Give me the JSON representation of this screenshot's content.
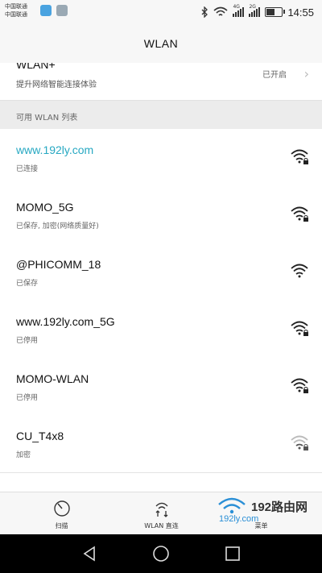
{
  "status_bar": {
    "carrier_1": "中国联通",
    "carrier_2": "中国联通",
    "net_1": "4G",
    "net_2": "2G",
    "time": "14:55"
  },
  "header": {
    "title": "WLAN"
  },
  "wlan_plus": {
    "name": "WLAN+",
    "subtitle": "提升网络智能连接体验",
    "value": "已开启"
  },
  "section": {
    "label": "可用 WLAN 列表"
  },
  "networks": [
    {
      "ssid": "www.192ly.com",
      "status": "已连接",
      "connected": true,
      "locked": true,
      "signal": 4
    },
    {
      "ssid": "MOMO_5G",
      "status": "已保存, 加密(网络质量好)",
      "connected": false,
      "locked": true,
      "signal": 4
    },
    {
      "ssid": "@PHICOMM_18",
      "status": "已保存",
      "connected": false,
      "locked": false,
      "signal": 4
    },
    {
      "ssid": "www.192ly.com_5G",
      "status": "已停用",
      "connected": false,
      "locked": true,
      "signal": 4
    },
    {
      "ssid": "MOMO-WLAN",
      "status": "已停用",
      "connected": false,
      "locked": true,
      "signal": 4
    },
    {
      "ssid": "CU_T4x8",
      "status": "加密",
      "connected": false,
      "locked": true,
      "signal": 2
    }
  ],
  "bottom_bar": {
    "scan_label": "扫描",
    "direct_label": "WLAN 直连",
    "menu_label": "菜单"
  },
  "watermark": {
    "brand": "192路由网",
    "url": "192ly.com"
  },
  "colors": {
    "connected_text": "#27a8c2",
    "watermark_url": "#2a8fd6"
  }
}
